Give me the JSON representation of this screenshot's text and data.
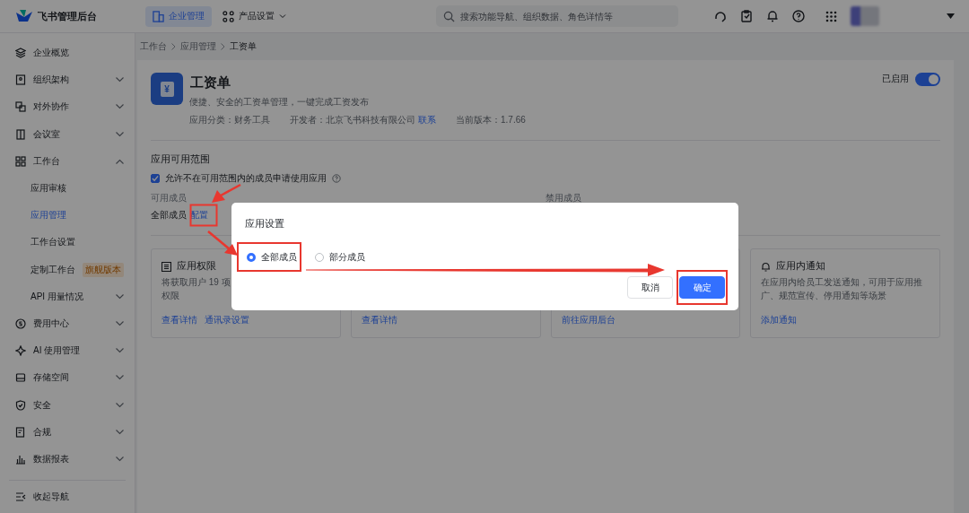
{
  "topbar": {
    "logo_text": "飞书管理后台",
    "nav": [
      {
        "label": "企业管理",
        "selected": true,
        "dropdown": false
      },
      {
        "label": "产品设置",
        "selected": false,
        "dropdown": true
      }
    ],
    "search": {
      "placeholder": "搜索功能导航、组织数据、角色详情等"
    }
  },
  "sidebar": {
    "items": [
      {
        "label": "企业概览",
        "selected": false
      },
      {
        "label": "组织架构",
        "selected": false,
        "expanded": false
      },
      {
        "label": "对外协作",
        "selected": false,
        "expanded": false
      },
      {
        "label": "会议室",
        "selected": false,
        "expanded": false
      },
      {
        "label": "工作台",
        "selected": false,
        "expanded": true,
        "children": [
          {
            "label": "应用审核",
            "selected": false
          },
          {
            "label": "应用管理",
            "selected": true
          },
          {
            "label": "工作台设置",
            "selected": false
          },
          {
            "label": "定制工作台",
            "selected": false,
            "badge": "旗舰版本"
          },
          {
            "label": "API 用量情况",
            "selected": false,
            "expanded": false
          }
        ]
      },
      {
        "label": "费用中心",
        "selected": false,
        "expanded": false
      },
      {
        "label": "AI 使用管理",
        "selected": false,
        "expanded": false
      },
      {
        "label": "存储空间",
        "selected": false,
        "expanded": false
      },
      {
        "label": "安全",
        "selected": false,
        "expanded": false
      },
      {
        "label": "合规",
        "selected": false,
        "expanded": false
      },
      {
        "label": "数据报表",
        "selected": false,
        "expanded": false
      }
    ],
    "collapse_label": "收起导航"
  },
  "breadcrumb": [
    "工作台",
    "应用管理",
    "工资单"
  ],
  "app": {
    "icon_glyph": "¥",
    "name": "工资单",
    "description": "便捷、安全的工资单管理，一键完成工资发布",
    "category": "应用分类：财务工具",
    "developer": "开发者：北京飞书科技有限公司",
    "contact_link": "联系",
    "version": "当前版本：1.7.66",
    "status_label": "已启用",
    "enabled": true
  },
  "scope": {
    "title": "应用可用范围",
    "allow_apply": {
      "label": "允许不在可用范围内的成员申请使用应用",
      "checked": true
    },
    "available_label": "可用成员",
    "available_value": "全部成员",
    "config_link": "配置",
    "disabled_label": "禁用成员"
  },
  "cards": [
    {
      "title": "应用权限",
      "description": [
        "将获取用户 19 项",
        "权限"
      ],
      "links": [
        "查看详情",
        "通讯录设置"
      ]
    },
    {
      "links": [
        "查看详情"
      ]
    },
    {
      "links": [
        "前往应用后台"
      ]
    },
    {
      "title": "应用内通知",
      "description": [
        "在应用内给员工发送通知，可用于应用推广、规范宣传、停用通知等场景"
      ],
      "links": [
        "添加通知"
      ]
    }
  ],
  "modal": {
    "title": "应用设置",
    "options": [
      {
        "label": "全部成员",
        "selected": true
      },
      {
        "label": "部分成员",
        "selected": false
      }
    ],
    "cancel": "取消",
    "confirm": "确定"
  }
}
